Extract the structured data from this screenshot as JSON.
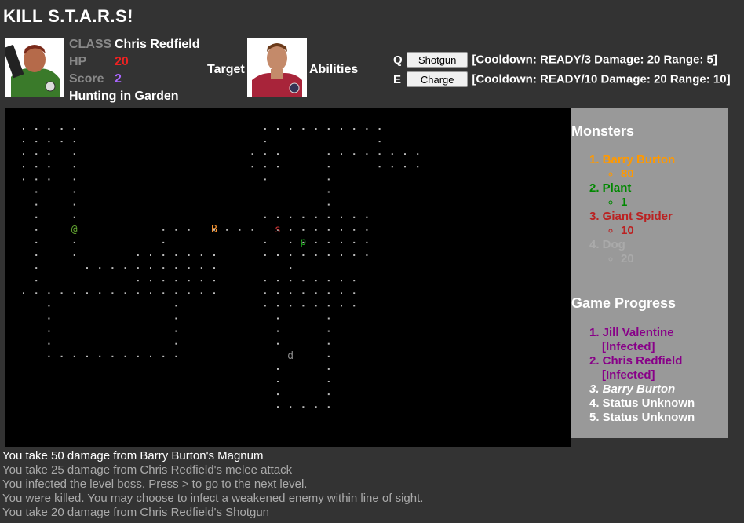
{
  "title": "KILL S.T.A.R.S!",
  "player": {
    "class_label": "CLASS",
    "class_value": "Chris Redfield",
    "hp_label": "HP",
    "hp_value": "20",
    "score_label": "Score",
    "score_value": "2",
    "status": "Hunting in Garden"
  },
  "target_label": "Target",
  "abilities_label": "Abilities",
  "abilities": [
    {
      "key": "Q",
      "button": "Shotgun",
      "info": "[Cooldown: READY/3 Damage: 20 Range: 5]"
    },
    {
      "key": "E",
      "button": "Charge",
      "info": "[Cooldown: READY/10 Damage: 20 Range: 10]"
    }
  ],
  "map": {
    "glyphs": [
      {
        "ch": "@",
        "color": "#6a3",
        "name": "player-glyph"
      },
      {
        "ch": "B",
        "color": "#f93",
        "name": "barry-glyph"
      },
      {
        "ch": "s",
        "color": "#c33",
        "name": "spider-glyph"
      },
      {
        "ch": "p",
        "color": "#2a2",
        "name": "plant-glyph"
      },
      {
        "ch": "d",
        "color": "#888",
        "name": "dog-glyph"
      }
    ]
  },
  "monsters": {
    "heading": "Monsters",
    "list": [
      {
        "num": "1.",
        "name": "Barry Burton",
        "hp": "80",
        "color": "#f90"
      },
      {
        "num": "2.",
        "name": "Plant",
        "hp": "1",
        "color": "#080"
      },
      {
        "num": "3.",
        "name": "Giant Spider",
        "hp": "10",
        "color": "#b22"
      },
      {
        "num": "4.",
        "name": "Dog",
        "hp": "20",
        "color": "#aaa"
      }
    ]
  },
  "progress": {
    "heading": "Game Progress",
    "list": [
      {
        "num": "1.",
        "line1": "Jill Valentine",
        "line2": "[Infected]",
        "color": "#808",
        "italic": false
      },
      {
        "num": "2.",
        "line1": "Chris Redfield",
        "line2": "[Infected]",
        "color": "#808",
        "italic": false
      },
      {
        "num": "3.",
        "line1": "Barry Burton",
        "line2": "",
        "color": "#fff",
        "italic": true
      },
      {
        "num": "4.",
        "line1": "Status Unknown",
        "line2": "",
        "color": "#fff",
        "italic": false
      },
      {
        "num": "5.",
        "line1": "Status Unknown",
        "line2": "",
        "color": "#fff",
        "italic": false
      }
    ]
  },
  "log": [
    {
      "text": "You take 50 damage from Barry Burton's Magnum",
      "color": "#fff"
    },
    {
      "text": "You take 25 damage from Chris Redfield's melee attack",
      "color": "#aaa"
    },
    {
      "text": "You infected the level boss. Press > to go to the next level.",
      "color": "#aaa"
    },
    {
      "text": "You were killed. You may choose to infect a weakened enemy within line of sight.",
      "color": "#aaa"
    },
    {
      "text": "You take 20 damage from Chris Redfield's Shotgun",
      "color": "#aaa"
    }
  ]
}
